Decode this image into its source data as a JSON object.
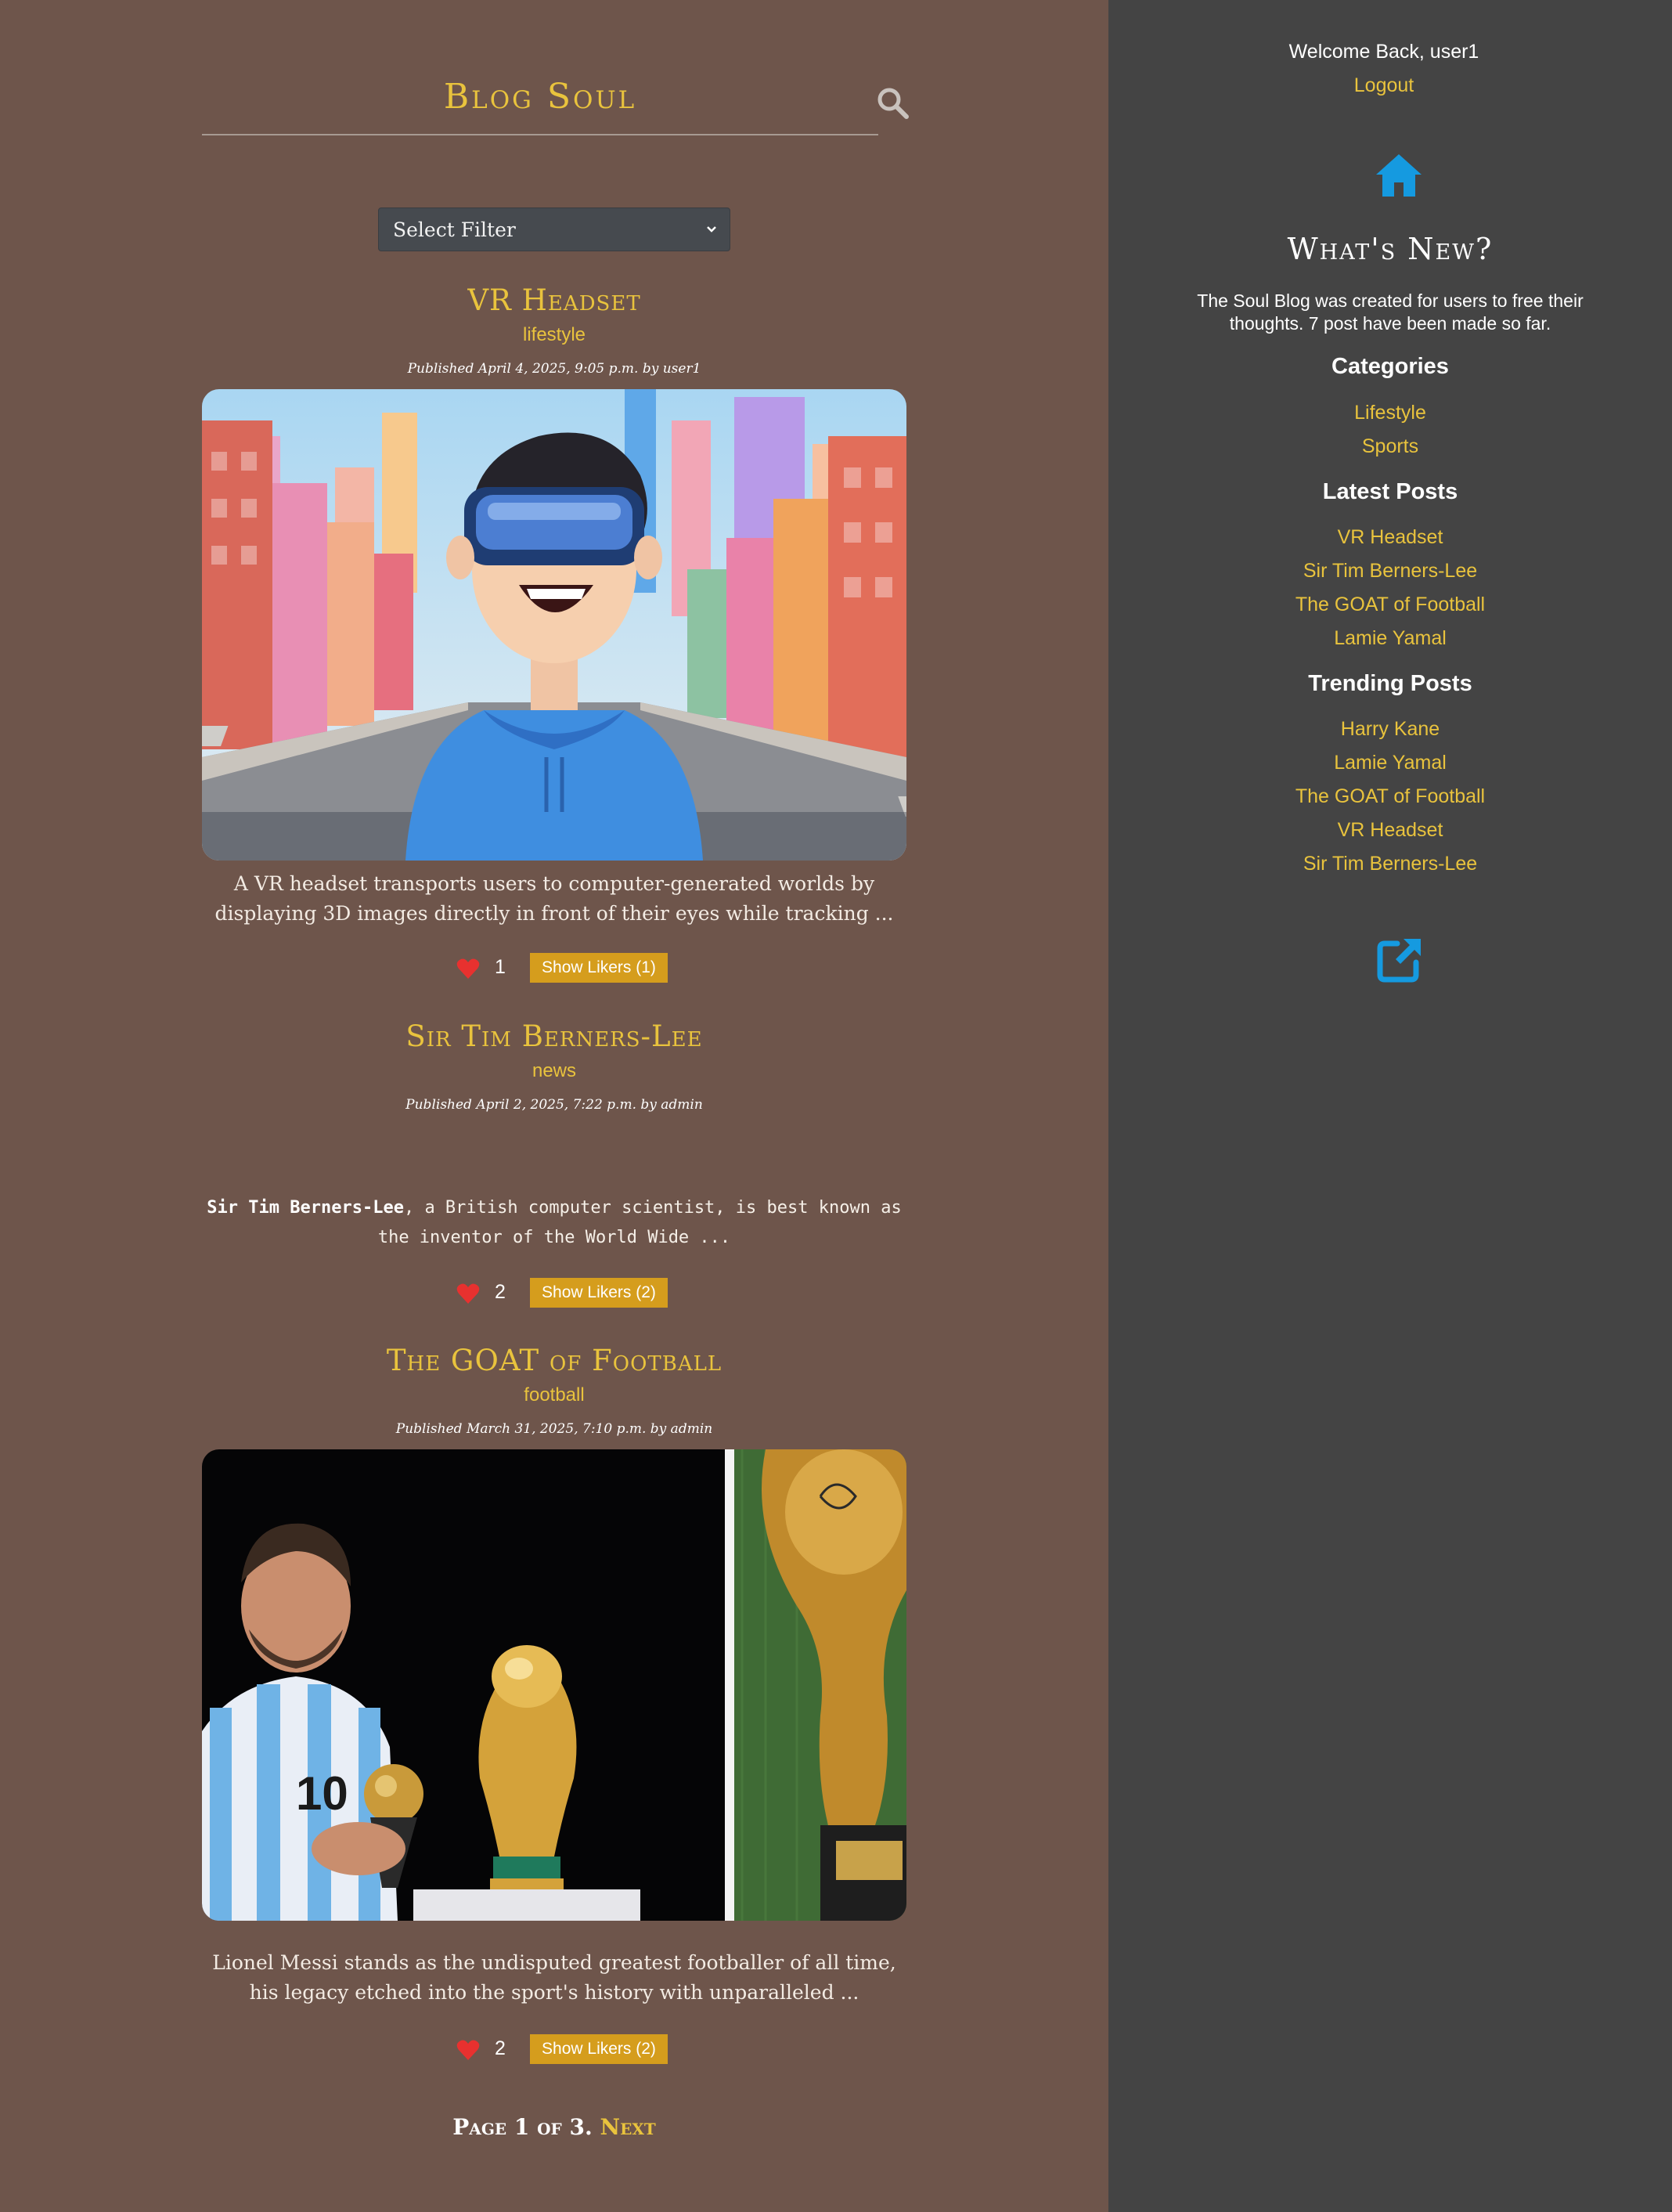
{
  "header": {
    "title": "Blog Soul"
  },
  "filter": {
    "selected": "Select Filter"
  },
  "posts": [
    {
      "title": "VR Headset",
      "category": "lifestyle",
      "meta": "Published April 4, 2025, 9:05 p.m. by user1",
      "excerpt": "A VR headset transports users to computer-generated worlds by displaying 3D images directly in front of their eyes while tracking ...",
      "likes": "1",
      "likers_label": "Show Likers (1)"
    },
    {
      "title": "Sir Tim Berners-Lee",
      "category": "news",
      "meta": "Published April 2, 2025, 7:22 p.m. by admin",
      "excerpt_bold": "Sir Tim Berners-Lee",
      "excerpt_rest": ", a British computer scientist, is best known as the inventor of the World Wide ...",
      "likes": "2",
      "likers_label": "Show Likers (2)"
    },
    {
      "title": "The GOAT of Football",
      "category": "football",
      "meta": "Published March 31, 2025, 7:10 p.m. by admin",
      "excerpt": "Lionel Messi stands as the undisputed greatest footballer of all time, his legacy etched into the sport's history with unparalleled ...",
      "likes": "2",
      "likers_label": "Show Likers (2)"
    }
  ],
  "pagination": {
    "text": "Page 1 of 3.",
    "next": "Next"
  },
  "sidebar": {
    "welcome": "Welcome Back, user1",
    "logout": "Logout",
    "whats_new": "What's New?",
    "about": "The Soul Blog was created for users to free their thoughts. 7 post have been made so far.",
    "categories_heading": "Categories",
    "categories": [
      "Lifestyle",
      "Sports"
    ],
    "latest_heading": "Latest Posts",
    "latest": [
      "VR Headset",
      "Sir Tim Berners-Lee",
      "The GOAT of Football",
      "Lamie Yamal"
    ],
    "trending_heading": "Trending Posts",
    "trending": [
      "Harry Kane",
      "Lamie Yamal",
      "The GOAT of Football",
      "VR Headset",
      "Sir Tim Berners-Lee"
    ]
  },
  "icons": {
    "search": "search-icon",
    "home": "home-icon",
    "external": "external-link-icon",
    "heart": "heart-icon"
  },
  "colors": {
    "main_bg": "#6e554b",
    "sidebar_bg": "#444444",
    "accent": "#e9c33d",
    "button": "#d59d1d",
    "icon_blue": "#159ae0"
  }
}
